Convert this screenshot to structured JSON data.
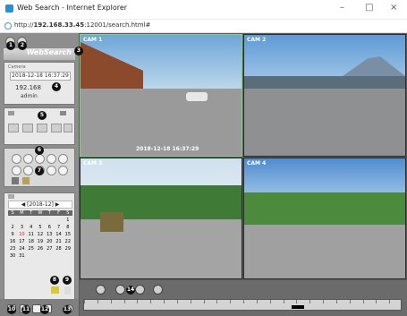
{
  "window": {
    "title": "Web Search - Internet Explorer",
    "min": "–",
    "max": "□",
    "close": "×"
  },
  "address": {
    "scheme": "http://",
    "host": "192.168.33.45",
    "path": ":12001/search.html#"
  },
  "app": {
    "banner": "WebSearch",
    "info": {
      "label": "Camera",
      "datetime": "2018-12-18 16:37:29",
      "ip": "192.168",
      "user": "admin"
    },
    "calendar": {
      "prev": "◀",
      "month": "[2018-12]",
      "next": "▶",
      "weekdays": [
        "S",
        "M",
        "T",
        "W",
        "T",
        "F",
        "S"
      ],
      "days": [
        "",
        "",
        "",
        "",
        "",
        "",
        "1",
        "2",
        "3",
        "4",
        "5",
        "6",
        "7",
        "8",
        "9",
        "10",
        "11",
        "12",
        "13",
        "14",
        "15",
        "16",
        "17",
        "18",
        "19",
        "20",
        "21",
        "22",
        "23",
        "24",
        "25",
        "26",
        "27",
        "28",
        "29",
        "30",
        "31"
      ]
    },
    "cameras": [
      {
        "label": "CAM 1",
        "timestamp": "2018-12-18 16:37:29"
      },
      {
        "label": "CAM 2",
        "timestamp": ""
      },
      {
        "label": "CAM 3",
        "timestamp": ""
      },
      {
        "label": "CAM 4",
        "timestamp": ""
      }
    ]
  },
  "markers": [
    "1",
    "2",
    "3",
    "4",
    "5",
    "6",
    "7",
    "8",
    "9",
    "10",
    "11",
    "12",
    "13",
    "14"
  ],
  "colors": {
    "panel": "#e9e9e9",
    "accent_green": "#7bd67b",
    "highlight_day": "#d22"
  }
}
